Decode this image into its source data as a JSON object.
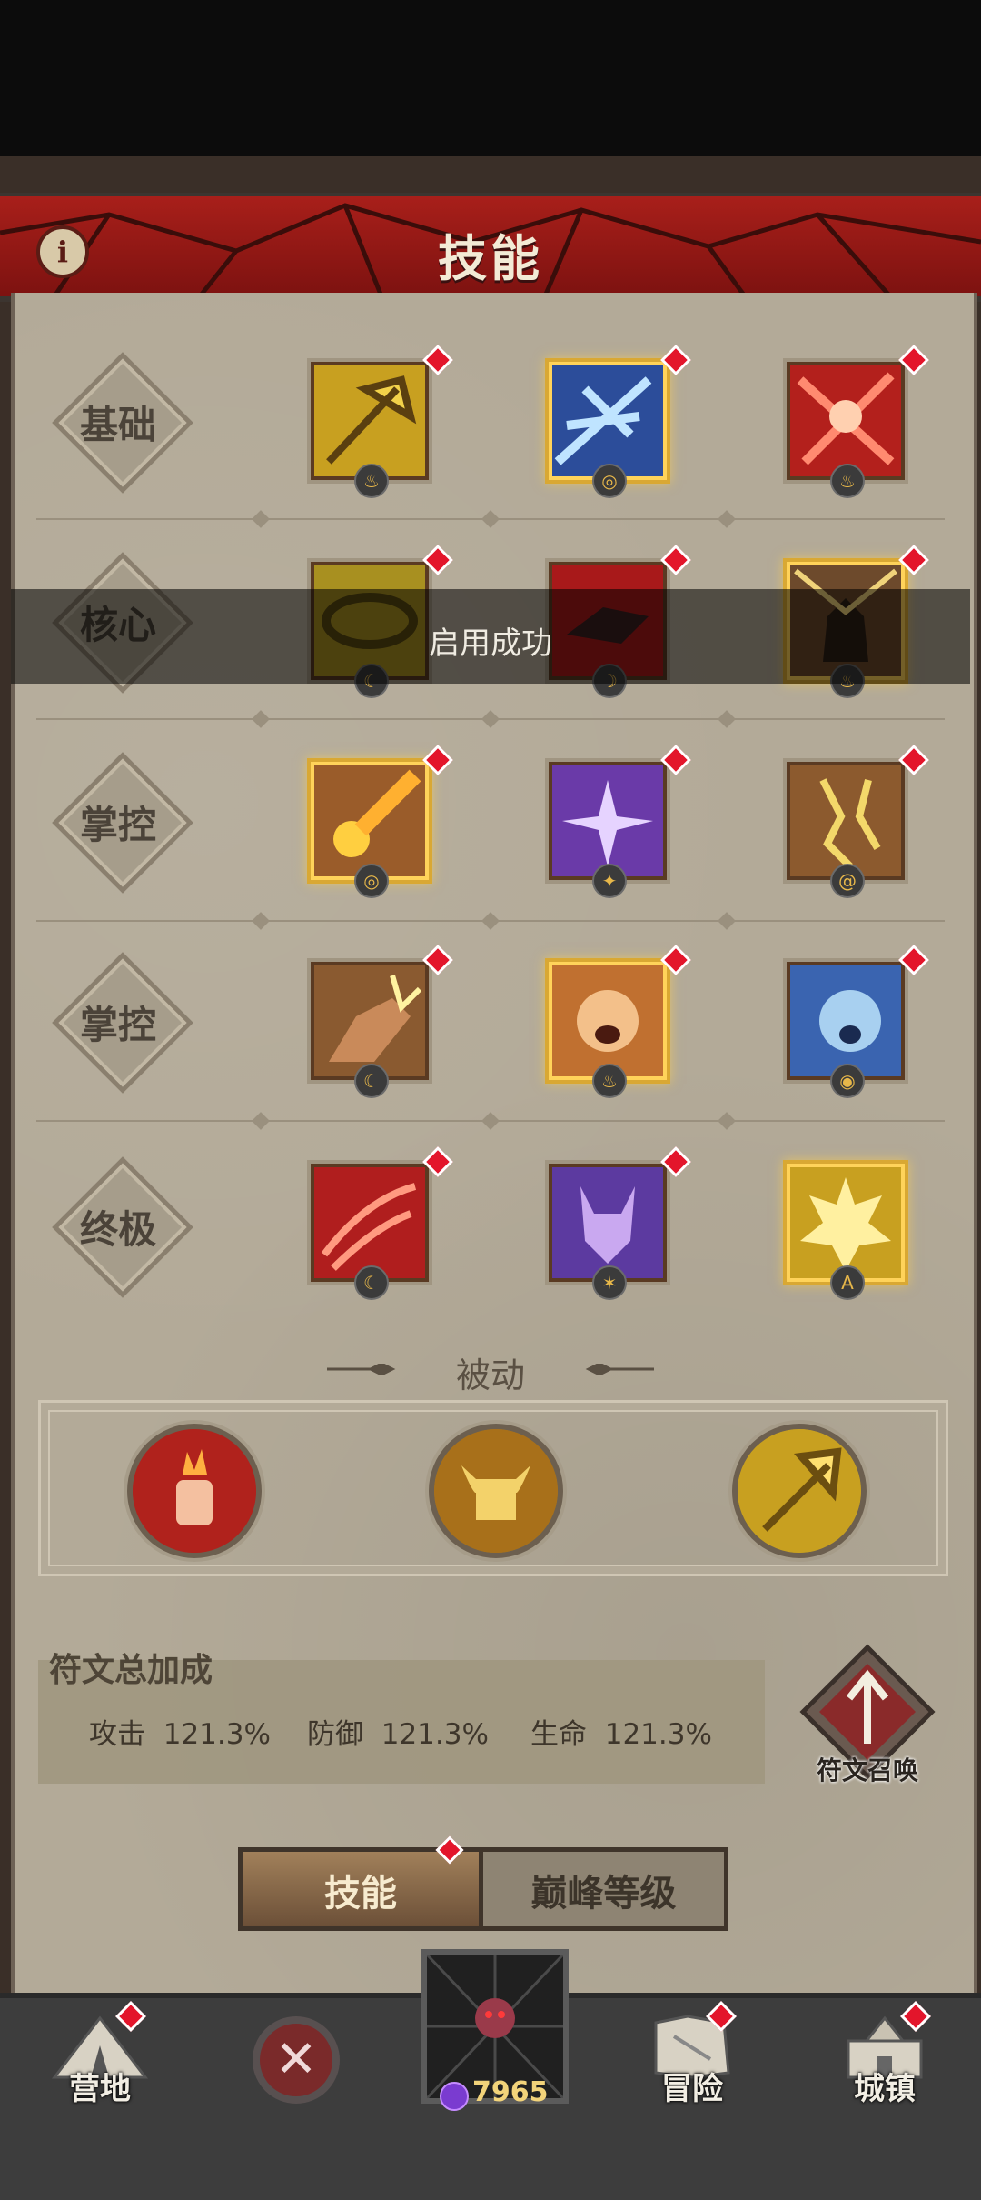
{
  "header": {
    "title": "技能",
    "info_symbol": "i"
  },
  "toast": {
    "message": "启用成功"
  },
  "rows": [
    {
      "label": "基础"
    },
    {
      "label": "核心"
    },
    {
      "label": "掌控"
    },
    {
      "label": "掌控"
    },
    {
      "label": "终极"
    }
  ],
  "skills": {
    "r0": [
      {
        "icon": "golden-axe-icon",
        "selected": false
      },
      {
        "icon": "ice-hammer-icon",
        "selected": true
      },
      {
        "icon": "red-warrior-strike-icon",
        "selected": false
      }
    ],
    "r1": [
      {
        "icon": "whirlwind-icon",
        "selected": false
      },
      {
        "icon": "blood-wolf-icon",
        "selected": false
      },
      {
        "icon": "stone-golem-icon",
        "selected": true
      }
    ],
    "r2": [
      {
        "icon": "fire-comet-icon",
        "selected": true
      },
      {
        "icon": "purple-burst-icon",
        "selected": false
      },
      {
        "icon": "earth-crack-icon",
        "selected": false
      }
    ],
    "r3": [
      {
        "icon": "charge-fist-icon",
        "selected": false
      },
      {
        "icon": "roar-beast-icon",
        "selected": true
      },
      {
        "icon": "frost-roar-icon",
        "selected": false
      }
    ],
    "r4": [
      {
        "icon": "red-dragon-slash-icon",
        "selected": false
      },
      {
        "icon": "purple-demon-icon",
        "selected": false
      },
      {
        "icon": "golden-avatar-icon",
        "selected": true
      }
    ]
  },
  "passive": {
    "title": "被动",
    "items": [
      {
        "icon": "flame-fist-icon"
      },
      {
        "icon": "horned-helmet-icon"
      },
      {
        "icon": "gold-axe-passive-icon"
      }
    ]
  },
  "rune": {
    "title": "符文总加成",
    "stats": [
      {
        "label": "攻击",
        "value": "121.3%"
      },
      {
        "label": "防御",
        "value": "121.3%"
      },
      {
        "label": "生命",
        "value": "121.3%"
      }
    ],
    "summon_label": "符文召唤"
  },
  "tabs": {
    "active": "技能",
    "inactive": "巅峰等级"
  },
  "nav": {
    "camp": "营地",
    "adventure": "冒险",
    "town": "城镇",
    "currency": "7965"
  },
  "colors": {
    "title_red": "#a81f1a",
    "notify_red": "#e3152b",
    "gold_select": "#ffd35a"
  }
}
